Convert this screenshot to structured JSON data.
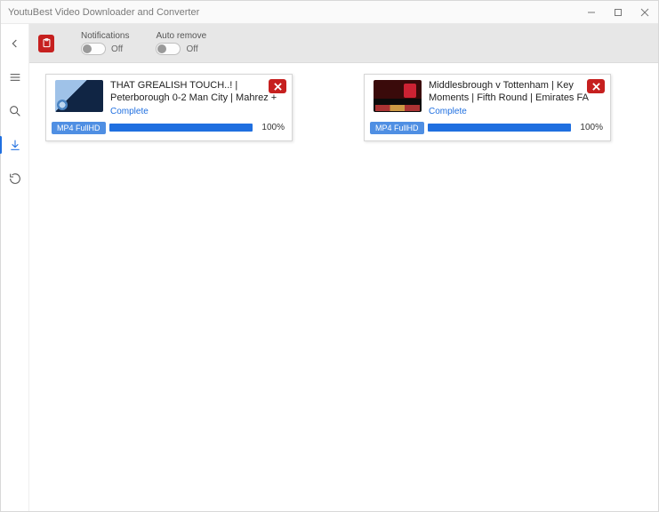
{
  "window": {
    "title": "YoutuBest Video Downloader and Converter"
  },
  "toolbar": {
    "notifications": {
      "label": "Notifications",
      "state": "Off"
    },
    "autoremove": {
      "label": "Auto remove",
      "state": "Off"
    }
  },
  "downloads": [
    {
      "title": "THAT GREALISH TOUCH..! | Peterborough 0-2 Man City | Mahrez +",
      "status": "Complete",
      "format": "MP4 FullHD",
      "percent": "100%"
    },
    {
      "title": "Middlesbrough v Tottenham | Key Moments | Fifth Round | Emirates FA",
      "status": "Complete",
      "format": "MP4 FullHD",
      "percent": "100%"
    }
  ]
}
